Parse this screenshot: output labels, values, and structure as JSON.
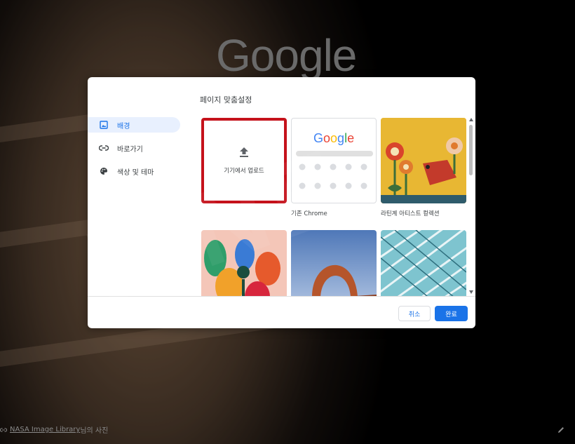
{
  "page": {
    "google_logo": "Google",
    "credit_link": "NASA Image Library",
    "credit_suffix": "님의 사진"
  },
  "dialog": {
    "title": "페이지 맞춤설정",
    "nav": [
      {
        "label": "배경",
        "icon": "background-icon",
        "active": true
      },
      {
        "label": "바로가기",
        "icon": "link-icon",
        "active": false
      },
      {
        "label": "색상 및 테마",
        "icon": "palette-icon",
        "active": false
      }
    ],
    "tiles": {
      "upload_label": "기기에서 업로드",
      "default_label": "기존 Chrome",
      "default_logo": "Google",
      "latin_label": "라틴계 아티스트 컬렉션"
    },
    "buttons": {
      "cancel": "취소",
      "done": "완료"
    }
  },
  "colors": {
    "accent": "#1a73e8",
    "highlight_border": "#c5121b"
  }
}
